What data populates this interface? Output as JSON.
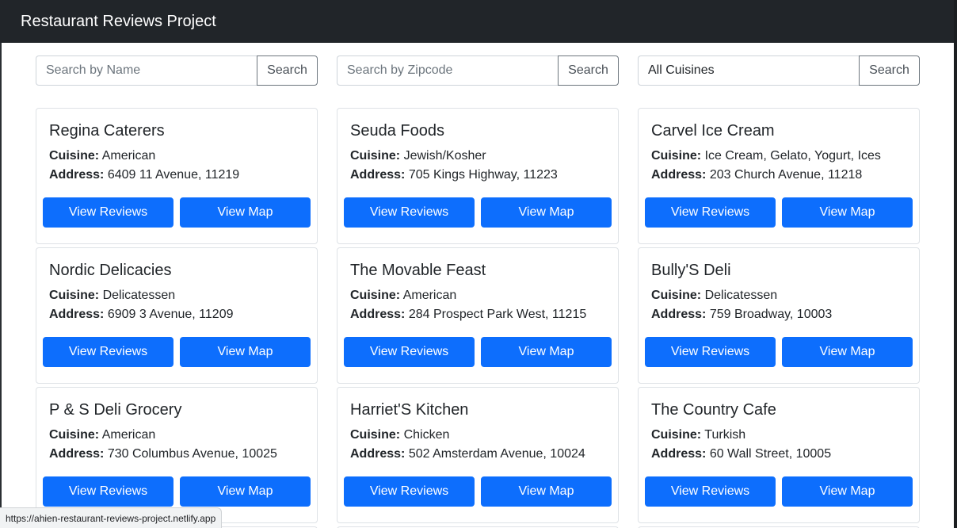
{
  "navbar": {
    "brand": "Restaurant Reviews Project"
  },
  "search": {
    "name_placeholder": "Search by Name",
    "zip_placeholder": "Search by Zipcode",
    "cuisine_selected": "All Cuisines",
    "button_label": "Search"
  },
  "labels": {
    "cuisine": "Cuisine:",
    "address": "Address:",
    "view_reviews": "View Reviews",
    "view_map": "View Map"
  },
  "restaurants": [
    {
      "name": "Regina Caterers",
      "cuisine": "American",
      "address": "6409 11 Avenue, 11219"
    },
    {
      "name": "Seuda Foods",
      "cuisine": "Jewish/Kosher",
      "address": "705 Kings Highway, 11223"
    },
    {
      "name": "Carvel Ice Cream",
      "cuisine": "Ice Cream, Gelato, Yogurt, Ices",
      "address": "203 Church Avenue, 11218"
    },
    {
      "name": "Nordic Delicacies",
      "cuisine": "Delicatessen",
      "address": "6909 3 Avenue, 11209"
    },
    {
      "name": "The Movable Feast",
      "cuisine": "American",
      "address": "284 Prospect Park West, 11215"
    },
    {
      "name": "Bully'S Deli",
      "cuisine": "Delicatessen",
      "address": "759 Broadway, 10003"
    },
    {
      "name": "P & S Deli Grocery",
      "cuisine": "American",
      "address": "730 Columbus Avenue, 10025"
    },
    {
      "name": "Harriet'S Kitchen",
      "cuisine": "Chicken",
      "address": "502 Amsterdam Avenue, 10024"
    },
    {
      "name": "The Country Cafe",
      "cuisine": "Turkish",
      "address": "60 Wall Street, 10005"
    }
  ],
  "status_bar": {
    "url": "https://ahien-restaurant-reviews-project.netlify.app"
  }
}
